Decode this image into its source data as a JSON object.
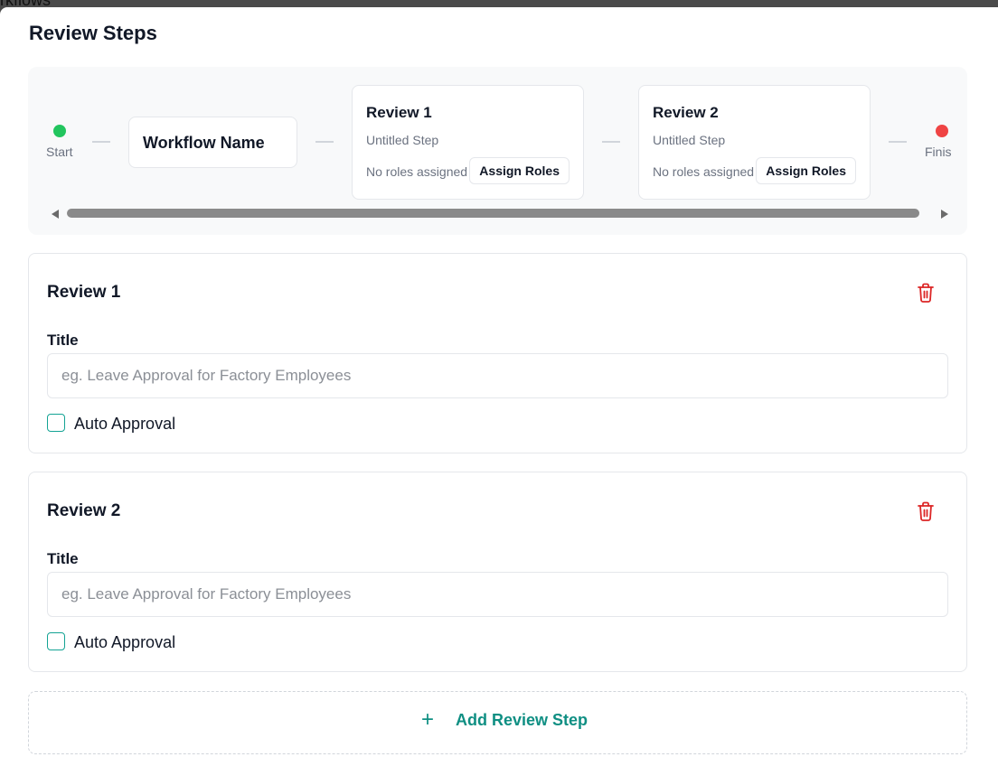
{
  "backdrop": {
    "text": "rkflows"
  },
  "modal": {
    "title": "Review Steps"
  },
  "flow": {
    "start": {
      "label": "Start",
      "color": "#22c55e"
    },
    "finish": {
      "label": "Finis",
      "color": "#ef4444"
    },
    "workflow_name": "Workflow Name",
    "steps": [
      {
        "title": "Review 1",
        "subtitle": "Untitled Step",
        "roles": "No roles assigned",
        "assign_label": "Assign Roles"
      },
      {
        "title": "Review 2",
        "subtitle": "Untitled Step",
        "roles": "No roles assigned",
        "assign_label": "Assign Roles"
      }
    ]
  },
  "sections": [
    {
      "title": "Review 1",
      "field_label": "Title",
      "placeholder": "eg. Leave Approval for Factory Employees",
      "value": "",
      "auto_approval_label": "Auto Approval",
      "auto_approval_checked": false
    },
    {
      "title": "Review 2",
      "field_label": "Title",
      "placeholder": "eg. Leave Approval for Factory Employees",
      "value": "",
      "auto_approval_label": "Auto Approval",
      "auto_approval_checked": false
    }
  ],
  "add_step": {
    "icon": "plus-icon",
    "label": "Add Review Step",
    "color": "#0f8f83"
  },
  "colors": {
    "accent": "#14a394",
    "danger": "#dc2626"
  }
}
